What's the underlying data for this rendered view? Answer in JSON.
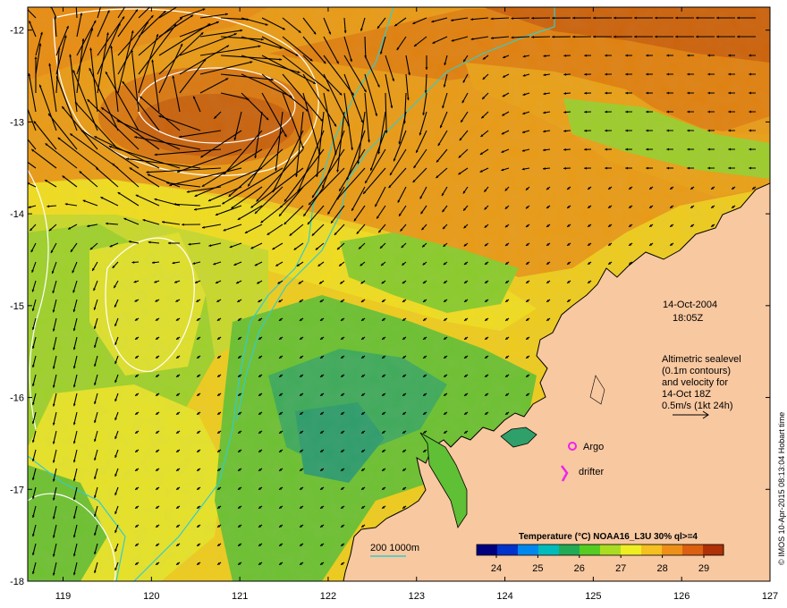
{
  "map": {
    "lon_ticks": [
      "119",
      "120",
      "121",
      "122",
      "123",
      "124",
      "125",
      "126",
      "127"
    ],
    "lat_ticks": [
      "-12",
      "-13",
      "-14",
      "-15",
      "-16",
      "-17",
      "-18"
    ],
    "lon_range": [
      118.6,
      127
    ],
    "lat_range": [
      -18,
      -11.75
    ],
    "date": "14-Oct-2004",
    "time": "18:05Z",
    "altimetry_note": [
      "Altimetric sealevel",
      "(0.1m contours)",
      "and velocity for",
      "14-Oct 18Z",
      "0.5m/s (1kt 24h)"
    ],
    "argo_label": "Argo",
    "drifter_label": "drifter",
    "bathy_label": "200  1000m",
    "credit": "© IMOS 10-Apr-2015 08:13:04 Hobart time"
  },
  "colorbar": {
    "title": "Temperature (°C) NOAA16_L3U 30% ql>=4",
    "ticks": [
      "24",
      "25",
      "26",
      "27",
      "28",
      "29"
    ],
    "colors": [
      "#00007f",
      "#0033cc",
      "#0088ee",
      "#00bbbb",
      "#22aa55",
      "#55cc22",
      "#aadd22",
      "#eeee22",
      "#f5c020",
      "#ee9018",
      "#dd6010",
      "#b03008"
    ]
  },
  "colors": {
    "land": "#f8c8a0",
    "sst_warm": "#e8900c",
    "sst_hot": "#c85a0a",
    "sst_mid": "#f2d81a",
    "sst_cool": "#7ccc22",
    "sst_cold": "#3ea35a",
    "contour": "#ffffff",
    "isobath": "#33cccc",
    "argo": "#ee22ee"
  }
}
